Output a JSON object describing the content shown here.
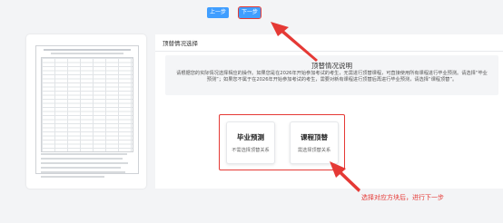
{
  "toolbar": {
    "prev_label": "上一步",
    "next_label": "下一步"
  },
  "panel": {
    "title": "顶替情况选择",
    "info_title": "顶替情况说明",
    "info_text": "请根据您的实际情况选择相应的操作。如果您是在2026年开始参加考试的考生，无需进行顶替课程，可直接使用所有课程进行毕业预测。请选择“毕业预测”；如果您不属于在2026年开始参加考试的考生，需要对新有课程进行顶替后再进行毕业预测，请选择“课程顶替”。"
  },
  "options": [
    {
      "title": "毕业预测",
      "subtitle": "不需选择顶替关系"
    },
    {
      "title": "课程顶替",
      "subtitle": "需选择顶替关系"
    }
  ],
  "annotation": "选择对应方块后，进行下一步",
  "colors": {
    "accent": "#409eff",
    "annotation": "#e53935"
  }
}
